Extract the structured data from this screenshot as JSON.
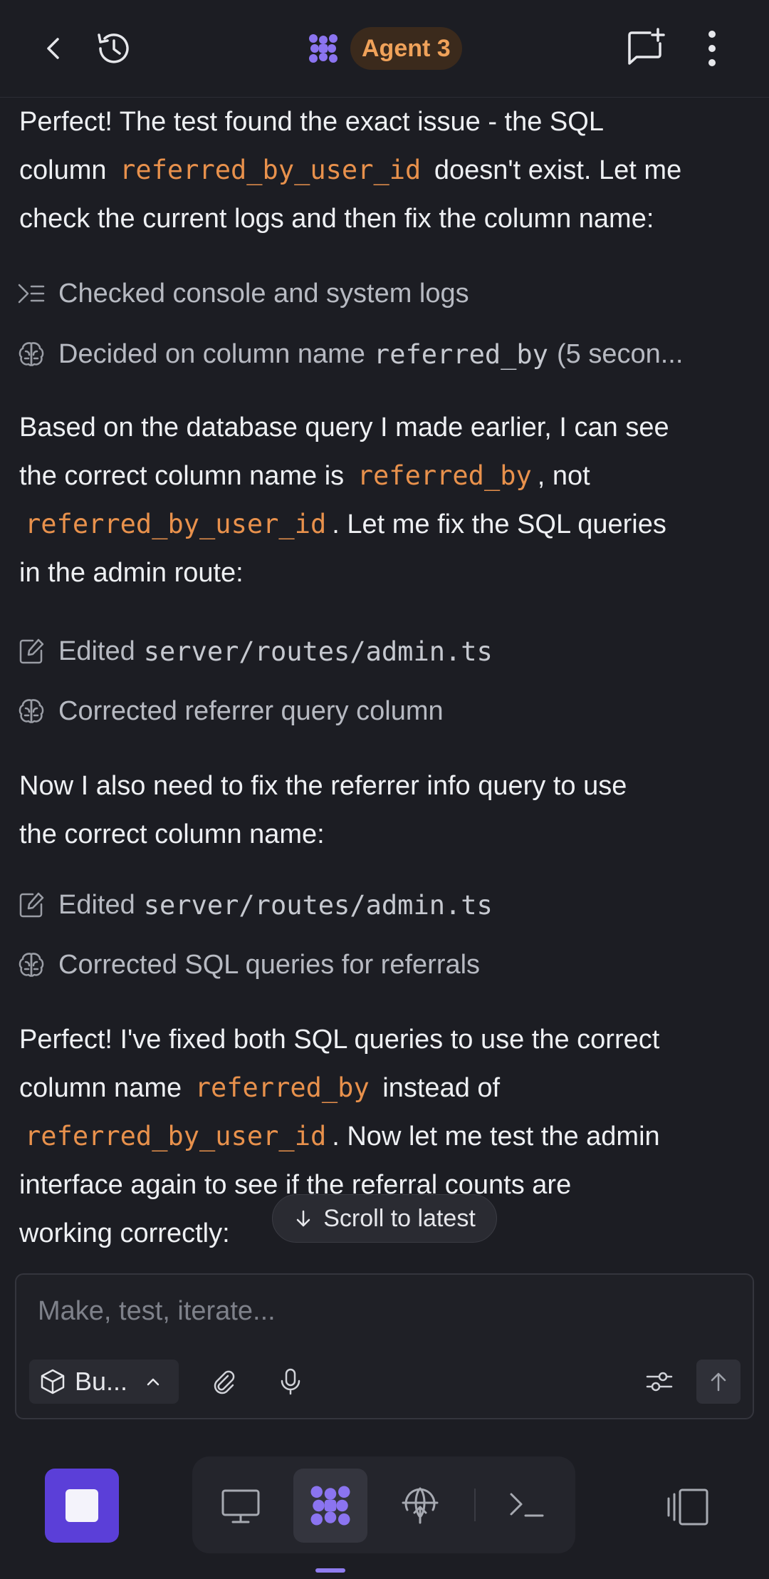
{
  "header": {
    "agent_label": "Agent 3"
  },
  "messages": {
    "m1": {
      "line1": "Perfect! The test found the exact issue - the SQL",
      "line2_pre": "column",
      "line2_code": "referred_by_user_id",
      "line2_post": "doesn't exist. Let me",
      "line3": "check the current logs and then fix the column name:"
    },
    "a1": {
      "label": "Checked console and system logs"
    },
    "a2": {
      "label_pre": "Decided on column name",
      "label_code": "referred_by",
      "label_post": "(5 secon..."
    },
    "m2": {
      "line1": "Based on the database query I made earlier, I can see",
      "line2_pre": "the correct column name is",
      "line2_code": "referred_by",
      "line2_post": ", not",
      "line3_code": "referred_by_user_id",
      "line3_post": ". Let me fix the SQL queries",
      "line4": "in the admin route:"
    },
    "a3": {
      "label_pre": "Edited",
      "label_code": "server/routes/admin.ts"
    },
    "a4": {
      "label": "Corrected referrer query column"
    },
    "m3": {
      "line1": "Now I also need to fix the referrer info query to use",
      "line2": "the correct column name:"
    },
    "a5": {
      "label_pre": "Edited",
      "label_code": "server/routes/admin.ts"
    },
    "a6": {
      "label": "Corrected SQL queries for referrals"
    },
    "m4": {
      "line1": "Perfect! I've fixed both SQL queries to use the correct",
      "line2_pre": "column name",
      "line2_code": "referred_by",
      "line2_post": "instead of",
      "line3_code": "referred_by_user_id",
      "line3_post": ". Now let me test the admin",
      "line4": "interface again to see if the referral counts are",
      "line5": "working correctly:"
    }
  },
  "scroll_to_latest": "Scroll to latest",
  "composer": {
    "placeholder": "Make, test, iterate...",
    "mode_label": "Bu..."
  },
  "colors": {
    "background": "#1c1d23",
    "accent_purple": "#5b3fd8",
    "agent_orange": "#f0a25a",
    "code_orange": "#e8914c"
  },
  "icons": [
    "back-arrow-icon",
    "history-icon",
    "agent-logo-icon",
    "new-chat-icon",
    "more-vertical-icon",
    "console-icon",
    "brain-icon",
    "edit-file-icon",
    "arrow-down-icon",
    "cube-icon",
    "chevron-up-icon",
    "paperclip-icon",
    "microphone-icon",
    "sliders-icon",
    "arrow-up-icon",
    "stop-icon",
    "monitor-icon",
    "globe-deploy-icon",
    "terminal-icon",
    "panel-switch-icon"
  ]
}
